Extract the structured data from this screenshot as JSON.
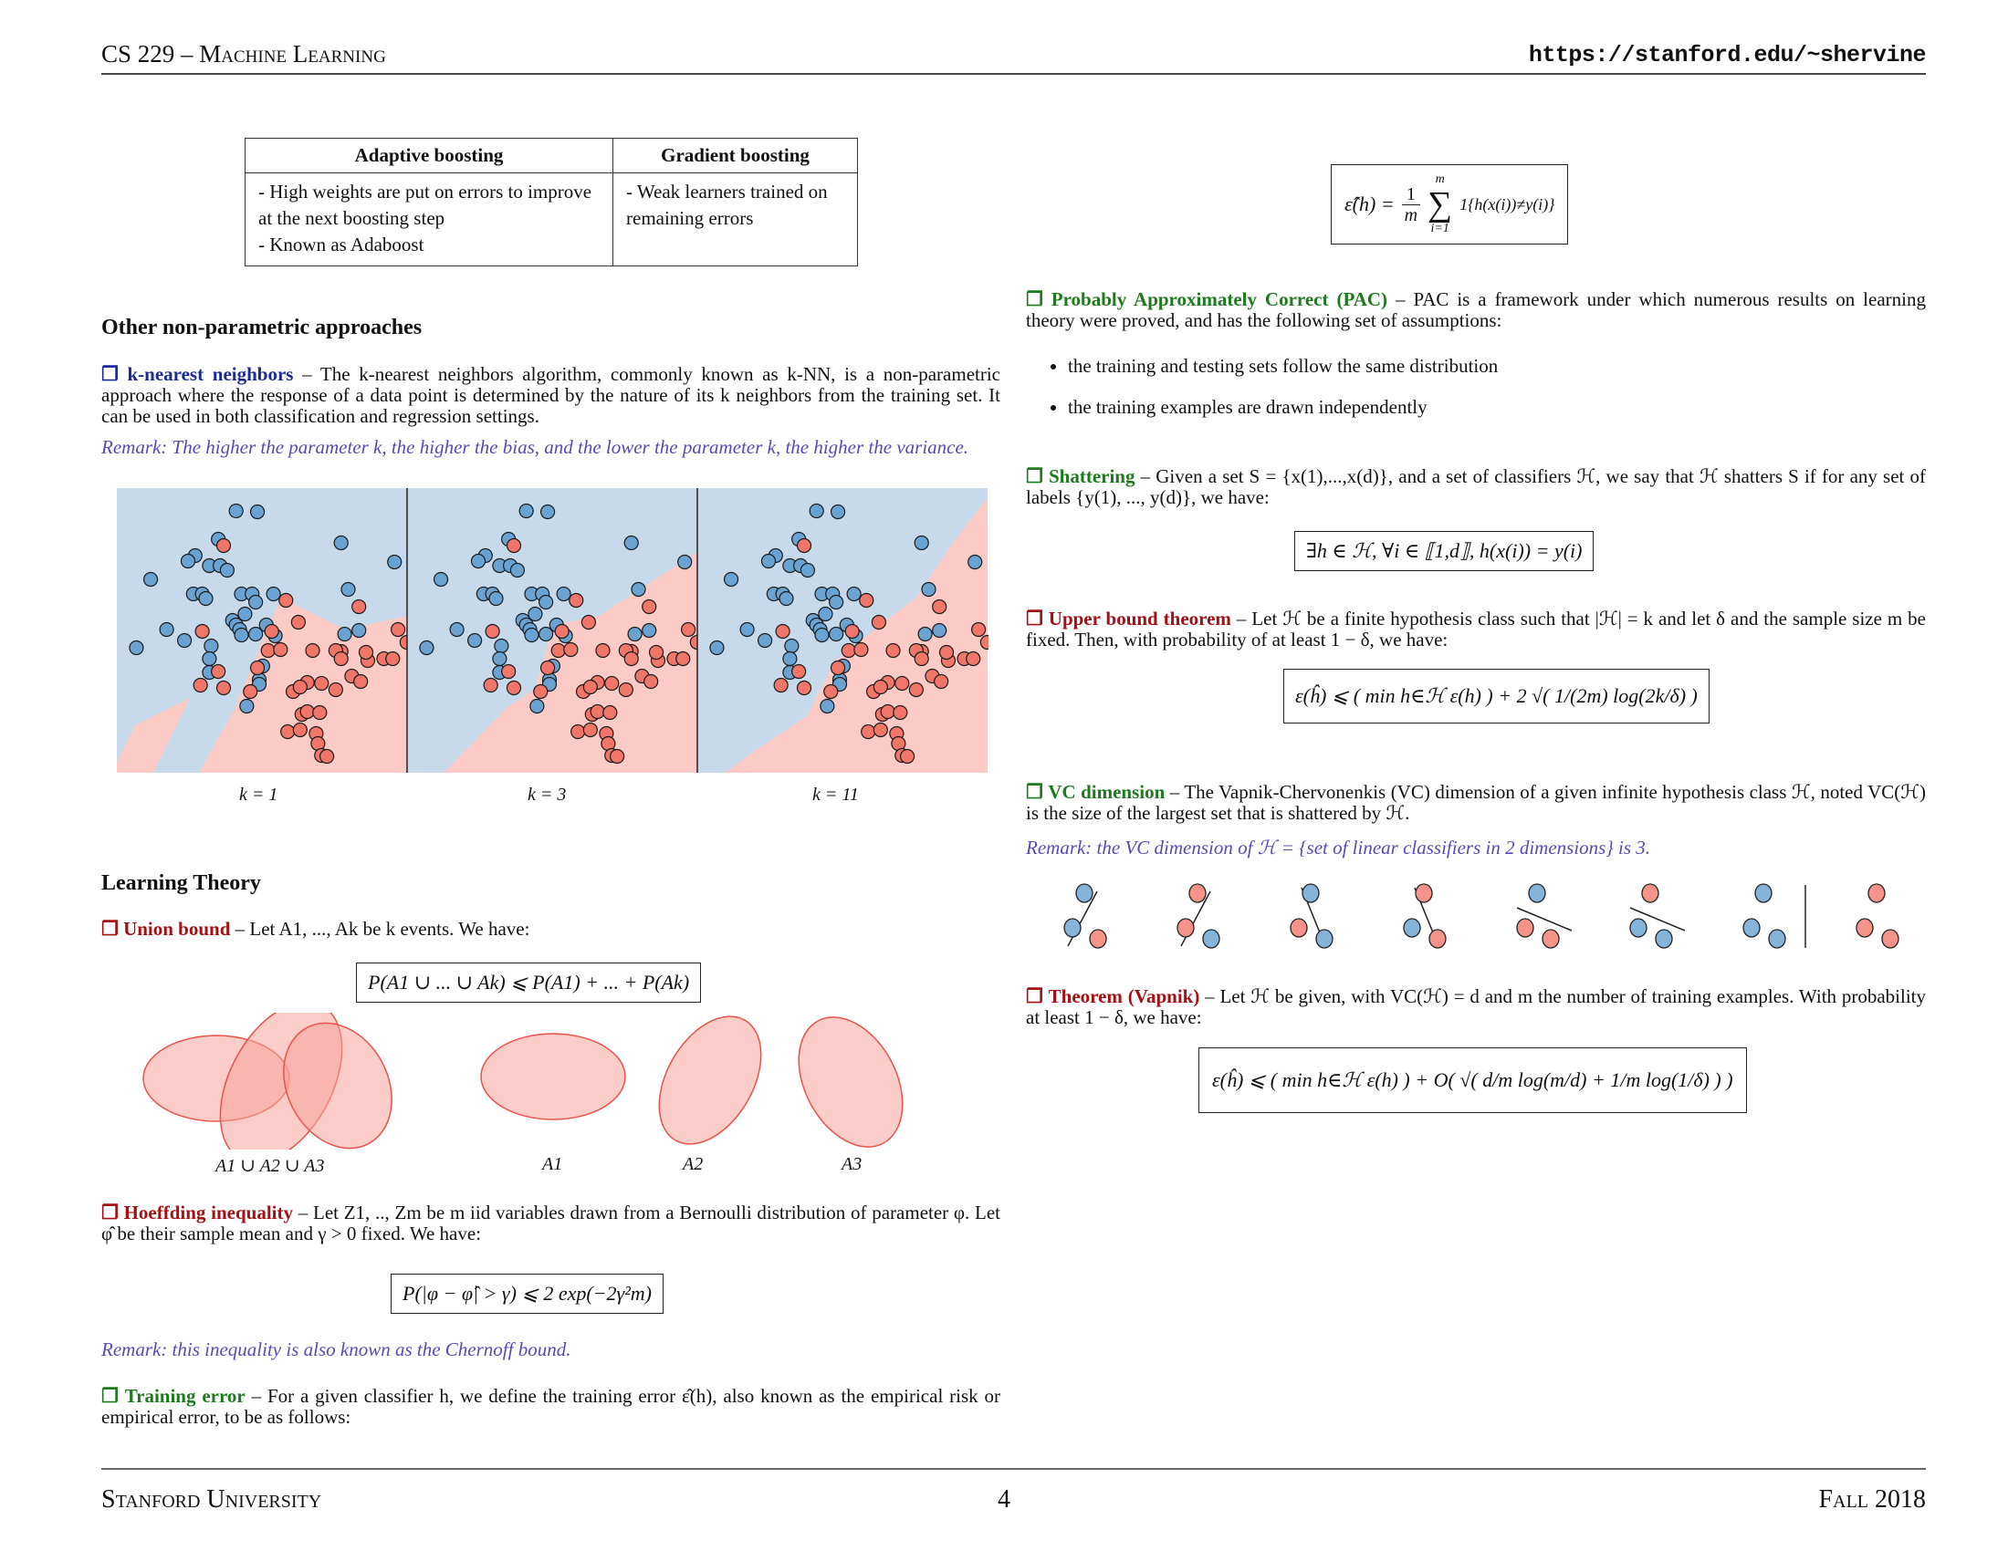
{
  "header": {
    "course": "CS 229 – Machine Learning",
    "url": "https://stanford.edu/~shervine"
  },
  "footer": {
    "institution": "Stanford University",
    "page_number": "4",
    "term": "Fall 2018"
  },
  "boosting_table": {
    "headers": [
      "Adaptive boosting",
      "Gradient boosting"
    ],
    "rows": [
      [
        "- High weights are put on errors to improve at the next boosting step",
        "- Weak learners trained on remaining errors"
      ],
      [
        "- Known as Adaboost",
        ""
      ]
    ]
  },
  "section_nonparam": {
    "title": "Other non-parametric approaches",
    "knn": {
      "marker": "❐",
      "term": "k-nearest neighbors",
      "text": " – The k-nearest neighbors algorithm, commonly known as k-NN, is a non-parametric approach where the response of a data point is determined by the nature of its k neighbors from the training set. It can be used in both classification and regression settings.",
      "remark": "Remark: The higher the parameter k, the higher the bias, and the lower the parameter k, the higher the variance."
    },
    "knn_figure": {
      "captions": [
        "k = 1",
        "k = 3",
        "k = 11"
      ],
      "colors": {
        "blue_region": "#c6daec",
        "red_region": "#fccbc6",
        "blue_point": "#6aa3d2",
        "red_point": "#f0766a"
      }
    }
  },
  "section_learning": {
    "title": "Learning Theory",
    "union_bound": {
      "marker": "❐",
      "term": "Union bound",
      "text": " – Let A1, ..., Ak be k events. We have:",
      "formula": "P(A1 ∪ ... ∪ Ak) ⩽ P(A1) + ... + P(Ak)",
      "captions": [
        "A1 ∪ A2 ∪ A3",
        "A1",
        "A2",
        "A3"
      ]
    },
    "hoeffding": {
      "marker": "❐",
      "term": "Hoeffding inequality",
      "text": " – Let Z1, .., Zm be m iid variables drawn from a Bernoulli distribution of parameter φ. Let φ̂ be their sample mean and γ > 0 fixed. We have:",
      "formula": "P(|φ − φ̂| > γ) ⩽ 2 exp(−2γ²m)",
      "remark": "Remark: this inequality is also known as the Chernoff bound."
    },
    "training_error": {
      "marker": "❐",
      "term": "Training error",
      "text": " – For a given classifier h, we define the training error ε̂(h), also known as the empirical risk or empirical error, to be as follows:",
      "formula_lhs": "ε̂(h) =",
      "formula_frac_num": "1",
      "formula_frac_den": "m",
      "formula_sum_top": "m",
      "formula_sum_bottom": "i=1",
      "formula_indicator": "1{h(x(i))≠y(i)}"
    },
    "pac": {
      "marker": "❐",
      "term": "Probably Approximately Correct (PAC)",
      "text": " – PAC is a framework under which numerous results on learning theory were proved, and has the following set of assumptions:",
      "bullets": [
        "the training and testing sets follow the same distribution",
        "the training examples are drawn independently"
      ]
    },
    "shattering": {
      "marker": "❐",
      "term": "Shattering",
      "text": " – Given a set S = {x(1),...,x(d)}, and a set of classifiers ℋ, we say that ℋ shatters S if for any set of labels {y(1), ..., y(d)}, we have:",
      "formula": "∃h ∈ ℋ,   ∀i ∈ ⟦1,d⟧,   h(x(i)) = y(i)"
    },
    "upper_bound": {
      "marker": "❐",
      "term": "Upper bound theorem",
      "text": " – Let ℋ be a finite hypothesis class such that |ℋ| = k and let δ and the sample size m be fixed. Then, with probability of at least 1 − δ, we have:",
      "formula": "ε(ĥ) ⩽ ( min h∈ℋ ε(h) ) + 2 √( 1/(2m) log(2k/δ) )"
    },
    "vc_dimension": {
      "marker": "❐",
      "term": "VC dimension",
      "text": " – The Vapnik-Chervonenkis (VC) dimension of a given infinite hypothesis class ℋ, noted VC(ℋ) is the size of the largest set that is shattered by ℋ.",
      "remark": "Remark: the VC dimension of ℋ = {set of linear classifiers in 2 dimensions} is 3.",
      "labelings": [
        [
          "blue",
          "blue",
          "red"
        ],
        [
          "red",
          "red",
          "blue"
        ],
        [
          "blue",
          "red",
          "blue"
        ],
        [
          "red",
          "blue",
          "red"
        ],
        [
          "blue",
          "red",
          "red"
        ],
        [
          "red",
          "blue",
          "blue"
        ],
        [
          "blue",
          "blue",
          "blue"
        ],
        [
          "red",
          "red",
          "red"
        ]
      ]
    },
    "vapnik": {
      "marker": "❐",
      "term": "Theorem (Vapnik)",
      "text": " – Let ℋ be given, with VC(ℋ) = d and m the number of training examples. With probability at least 1 − δ, we have:",
      "formula": "ε(ĥ) ⩽ ( min h∈ℋ ε(h) ) + O( √( d/m log(m/d) + 1/m log(1/δ) ) )"
    }
  }
}
